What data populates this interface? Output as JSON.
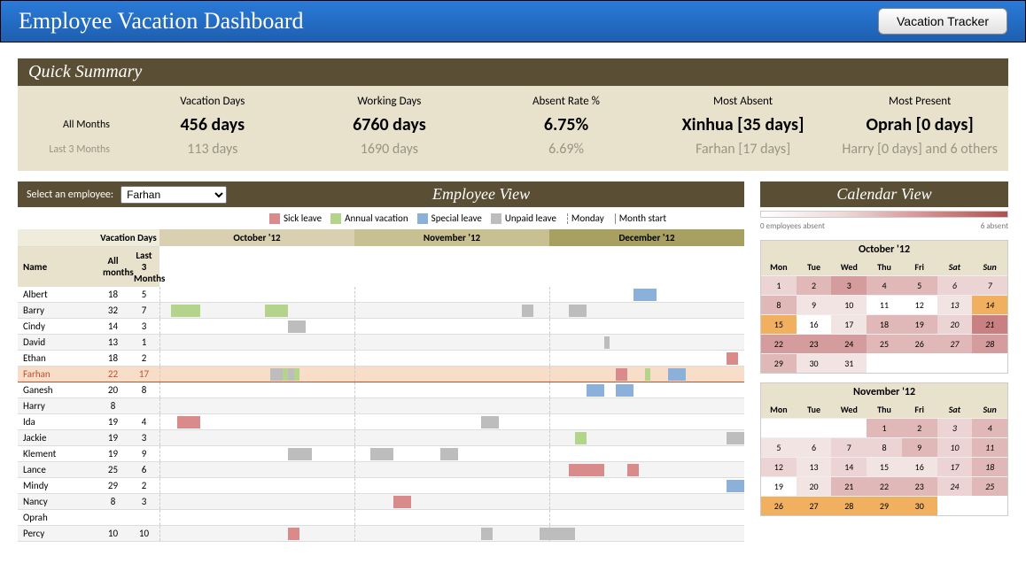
{
  "header": {
    "title": "Employee Vacation Dashboard",
    "tracker_button": "Vacation Tracker"
  },
  "quick_summary": {
    "title": "Quick Summary",
    "row_labels": [
      "All Months",
      "Last 3 Months"
    ],
    "cols": [
      {
        "hdr": "Vacation Days",
        "big": "456 days",
        "sub": "113 days"
      },
      {
        "hdr": "Working Days",
        "big": "6760 days",
        "sub": "1690 days"
      },
      {
        "hdr": "Absent Rate %",
        "big": "6.75%",
        "sub": "6.69%"
      },
      {
        "hdr": "Most Absent",
        "big": "Xinhua [35 days]",
        "sub": "Farhan [17 days]"
      },
      {
        "hdr": "Most Present",
        "big": "Oprah [0 days]",
        "sub": "Harry [0 days] and 6 others"
      }
    ]
  },
  "employee_view": {
    "select_label": "Select an employee:",
    "selected": "Farhan",
    "title": "Employee View",
    "legend": {
      "sick": "Sick leave",
      "annual": "Annual vacation",
      "special": "Special leave",
      "unpaid": "Unpaid leave",
      "monday": "Monday",
      "mstart": "Month start"
    },
    "table_headers": {
      "vacation_days": "Vacation Days",
      "name": "Name",
      "all_months": "All months",
      "last3": "Last 3 Months"
    },
    "months": [
      "October '12",
      "November '12",
      "December '12"
    ],
    "rows": [
      {
        "name": "Albert",
        "all": "18",
        "last3": "5",
        "bars": [
          {
            "t": "special",
            "s": 81,
            "w": 4
          }
        ]
      },
      {
        "name": "Barry",
        "all": "32",
        "last3": "7",
        "bars": [
          {
            "t": "annual",
            "s": 2,
            "w": 5
          },
          {
            "t": "annual",
            "s": 18,
            "w": 4
          },
          {
            "t": "unpaid",
            "s": 62,
            "w": 2
          },
          {
            "t": "unpaid",
            "s": 70,
            "w": 3
          }
        ]
      },
      {
        "name": "Cindy",
        "all": "14",
        "last3": "3",
        "bars": [
          {
            "t": "unpaid",
            "s": 22,
            "w": 3
          }
        ]
      },
      {
        "name": "David",
        "all": "13",
        "last3": "1",
        "bars": [
          {
            "t": "unpaid",
            "s": 76,
            "w": 1
          }
        ]
      },
      {
        "name": "Ethan",
        "all": "18",
        "last3": "2",
        "bars": [
          {
            "t": "sick",
            "s": 97,
            "w": 2
          }
        ]
      },
      {
        "name": "Farhan",
        "all": "22",
        "last3": "17",
        "bars": [
          {
            "t": "unpaid",
            "s": 19,
            "w": 2
          },
          {
            "t": "annual",
            "s": 21,
            "w": 1
          },
          {
            "t": "unpaid",
            "s": 22,
            "w": 1
          },
          {
            "t": "annual",
            "s": 23,
            "w": 1
          },
          {
            "t": "sick",
            "s": 78,
            "w": 2
          },
          {
            "t": "annual",
            "s": 83,
            "w": 1
          },
          {
            "t": "special",
            "s": 87,
            "w": 3
          }
        ]
      },
      {
        "name": "Ganesh",
        "all": "20",
        "last3": "8",
        "bars": [
          {
            "t": "special",
            "s": 73,
            "w": 3
          },
          {
            "t": "special",
            "s": 78,
            "w": 3
          }
        ]
      },
      {
        "name": "Harry",
        "all": "8",
        "last3": "",
        "bars": []
      },
      {
        "name": "Ida",
        "all": "19",
        "last3": "4",
        "bars": [
          {
            "t": "sick",
            "s": 3,
            "w": 4
          },
          {
            "t": "unpaid",
            "s": 55,
            "w": 3
          }
        ]
      },
      {
        "name": "Jackie",
        "all": "19",
        "last3": "3",
        "bars": [
          {
            "t": "annual",
            "s": 71,
            "w": 2
          },
          {
            "t": "unpaid",
            "s": 97,
            "w": 3
          }
        ]
      },
      {
        "name": "Klement",
        "all": "19",
        "last3": "9",
        "bars": [
          {
            "t": "unpaid",
            "s": 22,
            "w": 4
          },
          {
            "t": "unpaid",
            "s": 36,
            "w": 4
          },
          {
            "t": "unpaid",
            "s": 48,
            "w": 3
          }
        ]
      },
      {
        "name": "Lance",
        "all": "25",
        "last3": "6",
        "bars": [
          {
            "t": "sick",
            "s": 70,
            "w": 6
          },
          {
            "t": "sick",
            "s": 80,
            "w": 2
          }
        ]
      },
      {
        "name": "Mindy",
        "all": "29",
        "last3": "2",
        "bars": [
          {
            "t": "special",
            "s": 97,
            "w": 3
          }
        ]
      },
      {
        "name": "Nancy",
        "all": "8",
        "last3": "3",
        "bars": [
          {
            "t": "sick",
            "s": 40,
            "w": 3
          }
        ]
      },
      {
        "name": "Oprah",
        "all": "",
        "last3": "",
        "bars": []
      },
      {
        "name": "Percy",
        "all": "10",
        "last3": "10",
        "bars": [
          {
            "t": "sick",
            "s": 22,
            "w": 2
          },
          {
            "t": "unpaid",
            "s": 55,
            "w": 2
          },
          {
            "t": "unpaid",
            "s": 65,
            "w": 6
          }
        ]
      }
    ]
  },
  "calendar_view": {
    "title": "Calendar View",
    "legend_min": "0 employees absent",
    "legend_max": "6 absent",
    "dows": [
      "Mon",
      "Tue",
      "Wed",
      "Thu",
      "Fri",
      "Sat",
      "Sun"
    ],
    "cals": [
      {
        "title": "October '12",
        "offset": 0,
        "days": [
          {
            "d": 1,
            "h": 2
          },
          {
            "d": 2,
            "h": 3
          },
          {
            "d": 3,
            "h": 4
          },
          {
            "d": 4,
            "h": 3
          },
          {
            "d": 5,
            "h": 3
          },
          {
            "d": 6,
            "h": 2
          },
          {
            "d": 7,
            "h": 2
          },
          {
            "d": 8,
            "h": 3
          },
          {
            "d": 9,
            "h": 1
          },
          {
            "d": 10,
            "h": 1
          },
          {
            "d": 11,
            "h": 0
          },
          {
            "d": 12,
            "h": 0
          },
          {
            "d": 13,
            "h": 1
          },
          {
            "d": 14,
            "h": 0,
            "today": true
          },
          {
            "d": 15,
            "h": 3,
            "today": true
          },
          {
            "d": 16,
            "h": 0
          },
          {
            "d": 17,
            "h": 1
          },
          {
            "d": 18,
            "h": 3
          },
          {
            "d": 19,
            "h": 3
          },
          {
            "d": 20,
            "h": 2
          },
          {
            "d": 21,
            "h": 5
          },
          {
            "d": 22,
            "h": 4
          },
          {
            "d": 23,
            "h": 4
          },
          {
            "d": 24,
            "h": 4
          },
          {
            "d": 25,
            "h": 3
          },
          {
            "d": 26,
            "h": 3
          },
          {
            "d": 27,
            "h": 3
          },
          {
            "d": 28,
            "h": 4
          },
          {
            "d": 29,
            "h": 3
          },
          {
            "d": 30,
            "h": 1
          },
          {
            "d": 31,
            "h": 1
          }
        ]
      },
      {
        "title": "November '12",
        "offset": 3,
        "days": [
          {
            "d": 1,
            "h": 3
          },
          {
            "d": 2,
            "h": 3
          },
          {
            "d": 3,
            "h": 2
          },
          {
            "d": 4,
            "h": 3
          },
          {
            "d": 5,
            "h": 1
          },
          {
            "d": 6,
            "h": 1
          },
          {
            "d": 7,
            "h": 2
          },
          {
            "d": 8,
            "h": 2
          },
          {
            "d": 9,
            "h": 3
          },
          {
            "d": 10,
            "h": 2
          },
          {
            "d": 11,
            "h": 3
          },
          {
            "d": 12,
            "h": 2
          },
          {
            "d": 13,
            "h": 1
          },
          {
            "d": 14,
            "h": 2
          },
          {
            "d": 15,
            "h": 1
          },
          {
            "d": 16,
            "h": 1
          },
          {
            "d": 17,
            "h": 2
          },
          {
            "d": 18,
            "h": 3
          },
          {
            "d": 19,
            "h": 0
          },
          {
            "d": 20,
            "h": 1
          },
          {
            "d": 21,
            "h": 3
          },
          {
            "d": 22,
            "h": 3
          },
          {
            "d": 23,
            "h": 3
          },
          {
            "d": 24,
            "h": 2
          },
          {
            "d": 25,
            "h": 3
          },
          {
            "d": 26,
            "h": 0,
            "today": true
          },
          {
            "d": 27,
            "h": 3,
            "today": true
          },
          {
            "d": 28,
            "h": 3,
            "today": true
          },
          {
            "d": 29,
            "h": 3,
            "today": true
          },
          {
            "d": 30,
            "h": 3,
            "today": true
          }
        ]
      }
    ]
  },
  "chart_data": {
    "type": "table",
    "title": "Employee Vacation Days",
    "columns": [
      "Name",
      "All months",
      "Last 3 Months"
    ],
    "rows": [
      [
        "Albert",
        18,
        5
      ],
      [
        "Barry",
        32,
        7
      ],
      [
        "Cindy",
        14,
        3
      ],
      [
        "David",
        13,
        1
      ],
      [
        "Ethan",
        18,
        2
      ],
      [
        "Farhan",
        22,
        17
      ],
      [
        "Ganesh",
        20,
        8
      ],
      [
        "Harry",
        8,
        null
      ],
      [
        "Ida",
        19,
        4
      ],
      [
        "Jackie",
        19,
        3
      ],
      [
        "Klement",
        19,
        9
      ],
      [
        "Lance",
        25,
        6
      ],
      [
        "Mindy",
        29,
        2
      ],
      [
        "Nancy",
        8,
        3
      ],
      [
        "Oprah",
        null,
        null
      ],
      [
        "Percy",
        10,
        10
      ]
    ]
  }
}
